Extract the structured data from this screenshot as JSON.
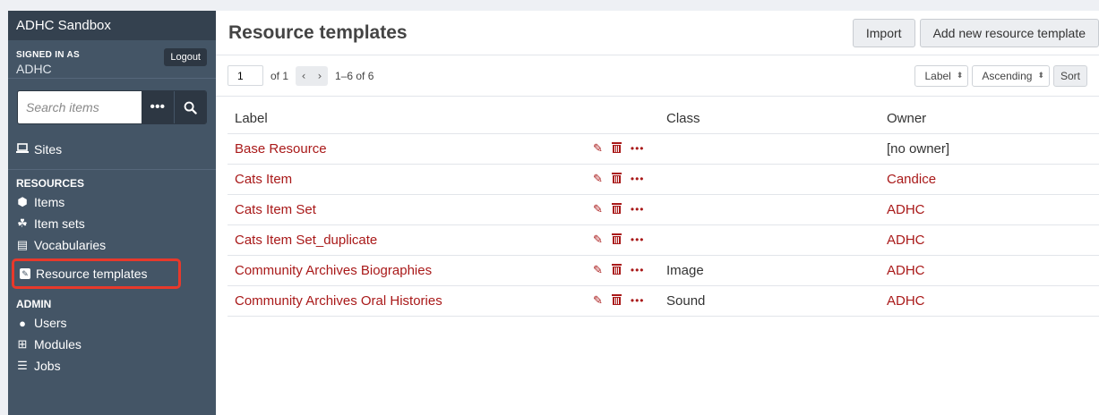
{
  "sidebar": {
    "site_title": "ADHC Sandbox",
    "signed_in_label": "SIGNED IN AS",
    "user_name": "ADHC",
    "logout_label": "Logout",
    "search_placeholder": "Search items",
    "nav_sites": "Sites",
    "resources_heading": "RESOURCES",
    "resources": [
      {
        "label": "Items",
        "icon": "cube-icon"
      },
      {
        "label": "Item sets",
        "icon": "cubes-icon"
      },
      {
        "label": "Vocabularies",
        "icon": "book-icon"
      },
      {
        "label": "Resource templates",
        "icon": "template-icon"
      }
    ],
    "admin_heading": "ADMIN",
    "admin": [
      {
        "label": "Users",
        "icon": "user-icon"
      },
      {
        "label": "Modules",
        "icon": "plus-square-icon"
      },
      {
        "label": "Jobs",
        "icon": "list-icon"
      }
    ]
  },
  "main": {
    "title": "Resource templates",
    "import_label": "Import",
    "add_label": "Add new resource template",
    "pagination": {
      "page": "1",
      "of_text": "of 1",
      "range_text": "1–6 of 6"
    },
    "sort": {
      "by": "Label",
      "order": "Ascending",
      "button": "Sort"
    },
    "columns": [
      "Label",
      "Class",
      "Owner"
    ],
    "rows": [
      {
        "label": "Base Resource",
        "class": "",
        "owner": "[no owner]"
      },
      {
        "label": "Cats Item",
        "class": "",
        "owner": "Candice"
      },
      {
        "label": "Cats Item Set",
        "class": "",
        "owner": "ADHC"
      },
      {
        "label": "Cats Item Set_duplicate",
        "class": "",
        "owner": "ADHC"
      },
      {
        "label": "Community Archives Biographies",
        "class": "Image",
        "owner": "ADHC"
      },
      {
        "label": "Community Archives Oral Histories",
        "class": "Sound",
        "owner": "ADHC"
      }
    ]
  },
  "colors": {
    "accent_red": "#a91919",
    "sidebar_bg": "#445566",
    "highlight": "#e8392b"
  }
}
